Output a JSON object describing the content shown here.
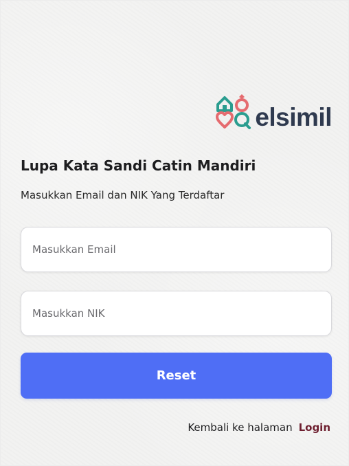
{
  "brand": {
    "name": "elsimil",
    "logo_icon": "house-ring-heart-chat-icon",
    "colors": {
      "teal": "#2a9d8f",
      "coral": "#e56b6f",
      "navy": "#2f3a4f"
    }
  },
  "page": {
    "title": "Lupa Kata Sandi Catin Mandiri",
    "subtitle": "Masukkan Email dan NIK Yang Terdaftar"
  },
  "form": {
    "email": {
      "value": "",
      "placeholder": "Masukkan Email"
    },
    "nik": {
      "value": "",
      "placeholder": "Masukkan NIK"
    },
    "reset_label": "Reset",
    "button_color": "#4f6ef5"
  },
  "footer": {
    "back_text": "Kembali ke halaman",
    "login_label": "Login",
    "login_color": "#6e1f2f"
  }
}
